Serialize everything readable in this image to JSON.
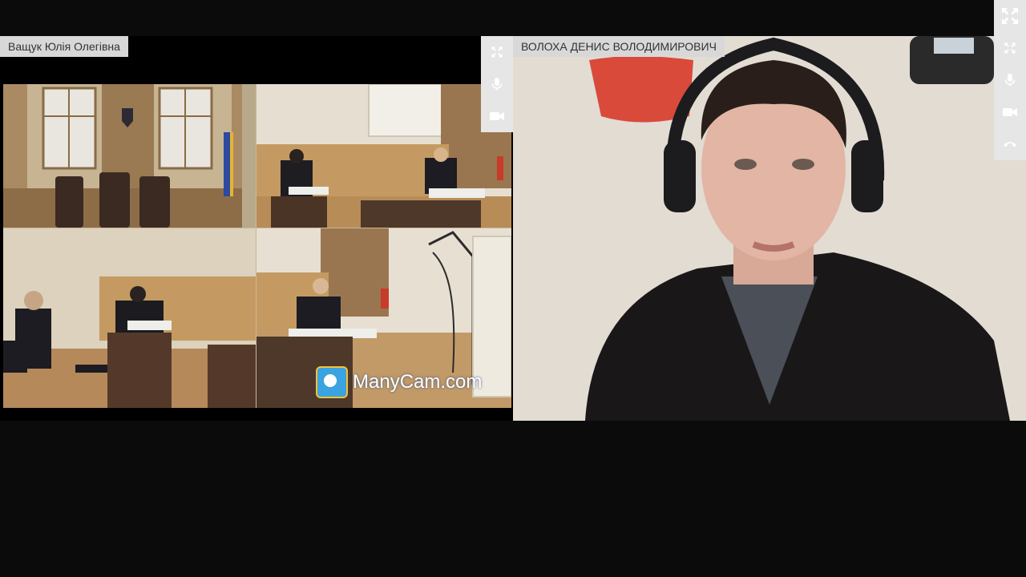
{
  "participants": {
    "left": {
      "name": "Ващук Юлія Олегівна"
    },
    "right": {
      "name": "ВОЛОХА ДЕНИС ВОЛОДИМИРОВИЧ"
    }
  },
  "stream": {
    "watermark": "ManyCam.com"
  },
  "controls": {
    "left": [
      "fullscreen-icon",
      "microphone-icon",
      "camera-icon"
    ],
    "right": [
      "fullscreen-icon",
      "microphone-icon",
      "camera-icon",
      "hangup-icon"
    ],
    "global": [
      "fullscreen-icon"
    ]
  },
  "colors": {
    "background": "#0b0b0b",
    "label_bg": "#d8d8d8",
    "control_bg": "#e6e6e6",
    "icon": "#ffffff"
  }
}
